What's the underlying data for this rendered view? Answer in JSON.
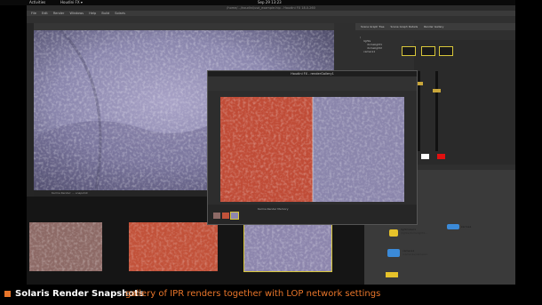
{
  "system_bar": {
    "activities": "Activities",
    "app_menu": "Houdini FX ▾",
    "clock": "Sep 29 13:23"
  },
  "window_title": "/home/.../houdini/usd_example.hip - Houdini FX 18.0.260",
  "menu": [
    "File",
    "Edit",
    "Render",
    "Windows",
    "Help",
    "Build",
    "Solaris"
  ],
  "right_panel": {
    "tabs": [
      "Scene Graph Tree",
      "Scene Graph Details",
      "Render Gallery"
    ],
    "tree_rows": [
      "/",
      "lights",
      "domelight1",
      "domelight2",
      "camera1"
    ]
  },
  "float_window": {
    "title": "Houdini FX - renderGallery1",
    "status": "Karma Render Memory"
  },
  "viewport_status": "Karma Render: ... snapshot",
  "network": {
    "nodes": [
      {
        "name": "lightmixer1",
        "sub": "/lights/domelight1..."
      },
      {
        "name": "camera1",
        "sub": "/cameras/camera1"
      },
      {
        "name": "karma1",
        "sub": ""
      }
    ]
  },
  "caption": {
    "title": "Solaris Render Snapshots",
    "description": "gallery of IPR renders together with LOP network settings"
  },
  "colors": {
    "accent": "#e8752a",
    "node_yellow": "#e6c22a",
    "node_blue": "#3b8ad8",
    "mute_red": "#e01010",
    "mute_white": "#ffffff"
  }
}
